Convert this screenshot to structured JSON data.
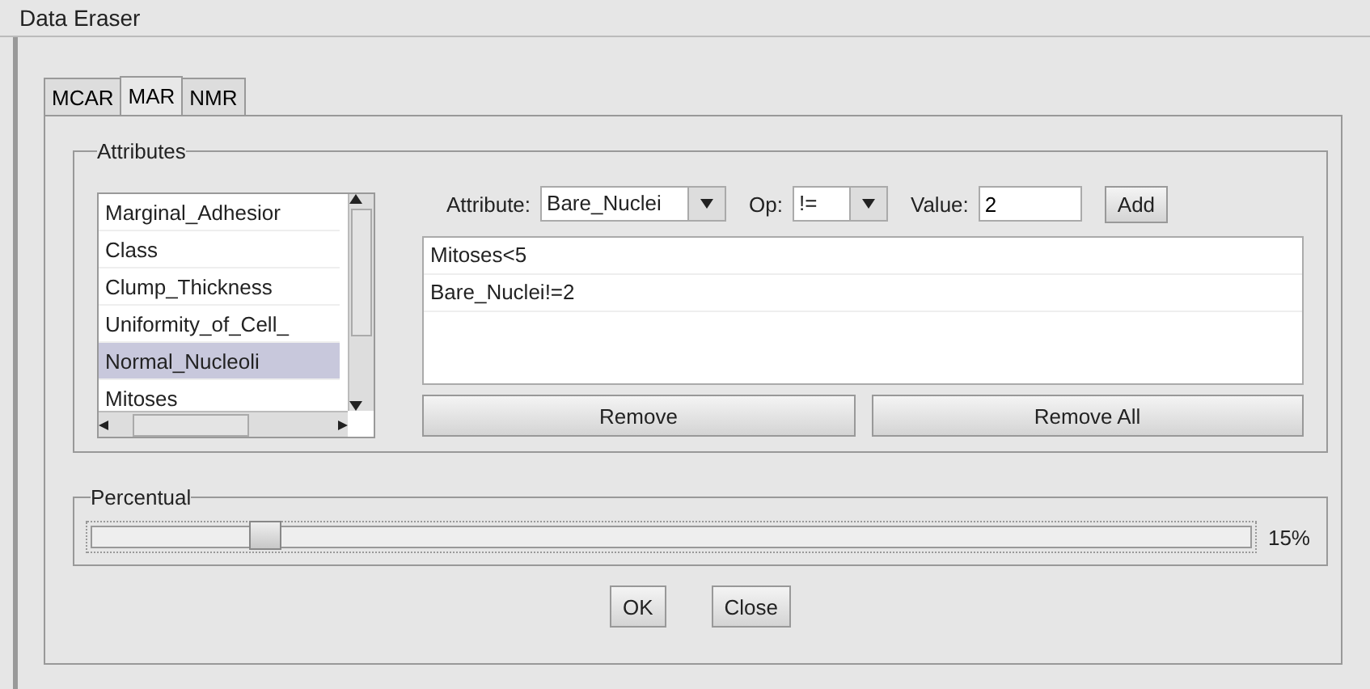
{
  "window": {
    "title": "Data Eraser"
  },
  "tabs": [
    {
      "label": "MCAR",
      "selected": false
    },
    {
      "label": "MAR",
      "selected": true
    },
    {
      "label": "NMR",
      "selected": false
    }
  ],
  "attributes": {
    "title": "Attributes",
    "list": [
      {
        "label": "Marginal_Adhesior",
        "selected": false
      },
      {
        "label": "Class",
        "selected": false
      },
      {
        "label": "Clump_Thickness",
        "selected": false
      },
      {
        "label": "Uniformity_of_Cell_",
        "selected": false
      },
      {
        "label": "Normal_Nucleoli",
        "selected": true
      },
      {
        "label": "Mitoses",
        "selected": false
      }
    ],
    "attribute_label": "Attribute:",
    "attribute_value": "Bare_Nuclei",
    "op_label": "Op:",
    "op_value": "!=",
    "value_label": "Value:",
    "value": "2",
    "add_button": "Add",
    "conditions": [
      "Mitoses<5",
      "Bare_Nuclei!=2"
    ],
    "remove_button": "Remove",
    "remove_all_button": "Remove All"
  },
  "percentual": {
    "title": "Percentual",
    "level": 0.15,
    "reading": "15%"
  },
  "buttons": [
    "OK",
    "Close"
  ]
}
